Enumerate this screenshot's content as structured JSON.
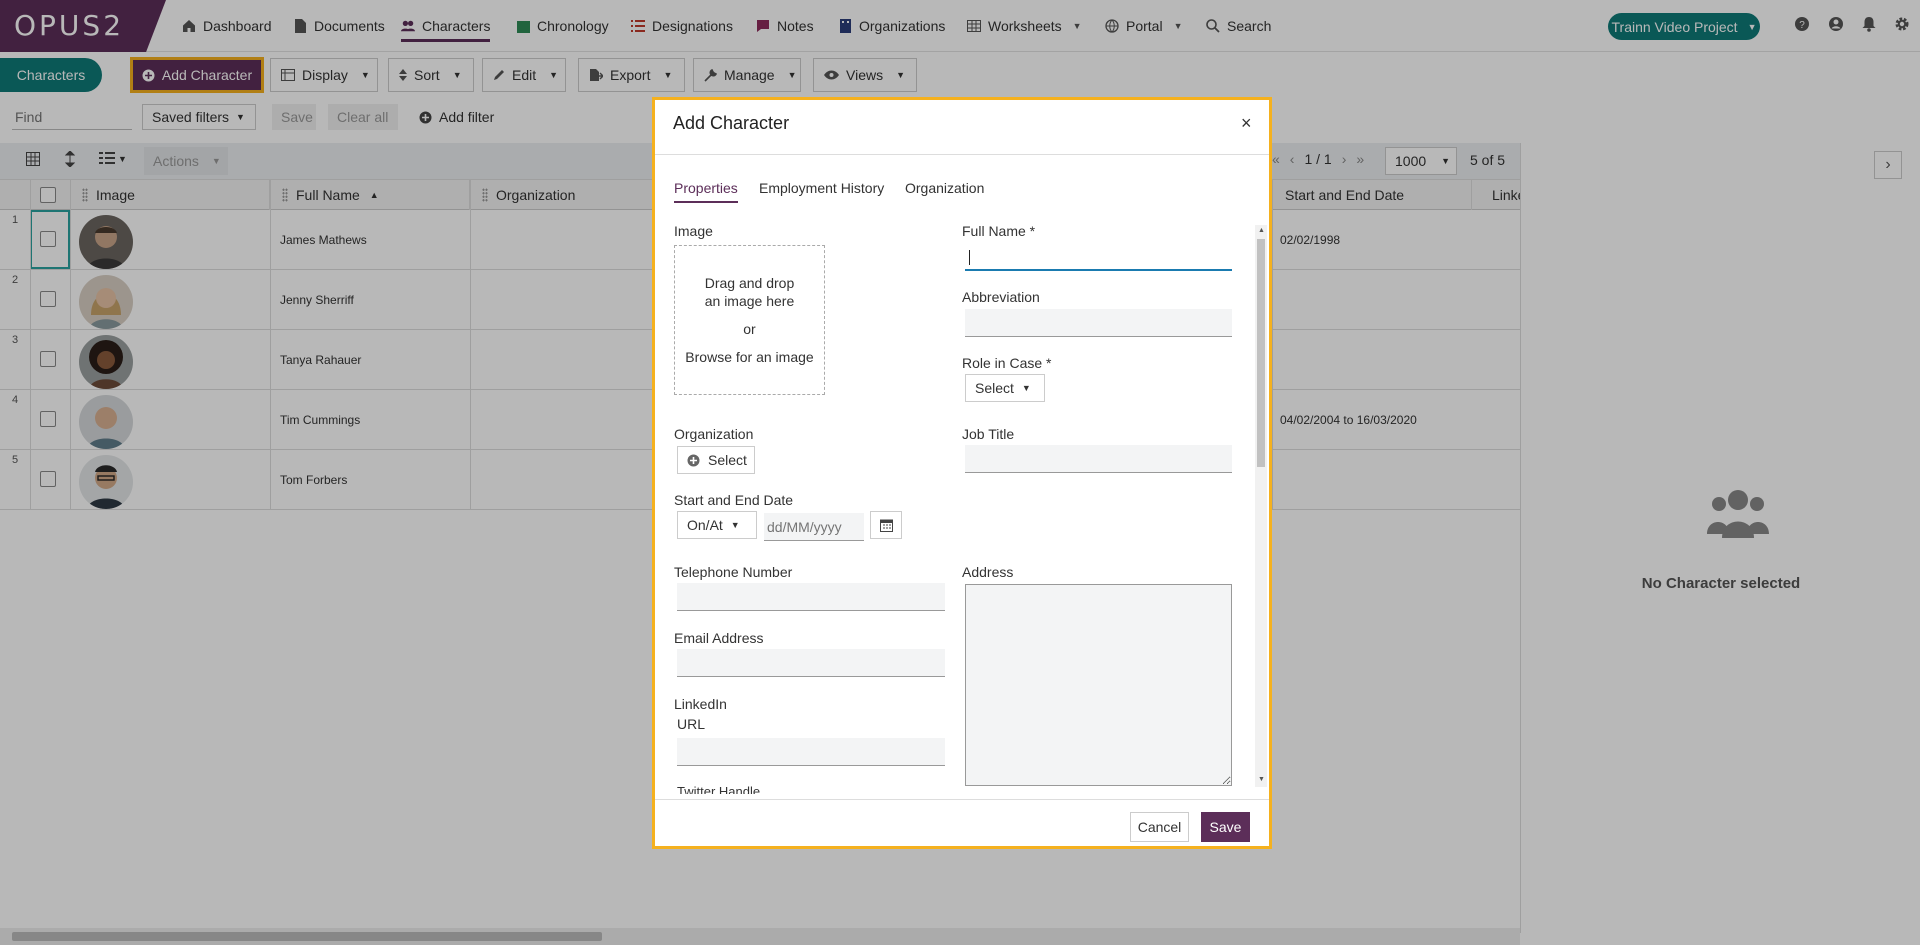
{
  "app": {
    "logo": "OPUS2"
  },
  "nav": {
    "items": [
      {
        "label": "Dashboard",
        "icon": "home-icon"
      },
      {
        "label": "Documents",
        "icon": "document-icon"
      },
      {
        "label": "Characters",
        "icon": "users-icon",
        "active": true
      },
      {
        "label": "Chronology",
        "icon": "calendar-icon"
      },
      {
        "label": "Designations",
        "icon": "list-icon"
      },
      {
        "label": "Notes",
        "icon": "note-icon"
      },
      {
        "label": "Organizations",
        "icon": "building-icon"
      },
      {
        "label": "Worksheets",
        "icon": "table-icon"
      },
      {
        "label": "Portal",
        "icon": "globe-icon"
      },
      {
        "label": "Search",
        "icon": "search-icon"
      }
    ],
    "project": "Trainn Video Project"
  },
  "toolbar": {
    "characters_tab": "Characters",
    "add_character": "Add Character",
    "display": "Display",
    "sort": "Sort",
    "edit": "Edit",
    "export": "Export",
    "manage": "Manage",
    "views": "Views"
  },
  "filters": {
    "find_placeholder": "Find",
    "saved_filters": "Saved filters",
    "save": "Save",
    "clear_all": "Clear all",
    "add_filter": "Add filter"
  },
  "grid_toolbar": {
    "actions": "Actions",
    "pagination": "1 / 1",
    "page_size": "1000",
    "count": "5 of 5"
  },
  "grid": {
    "columns": [
      "Image",
      "Full Name",
      "Organization",
      "Start and End Date",
      "Linke"
    ],
    "rows": [
      {
        "num": "1",
        "name": "James Mathews",
        "date": "02/02/1998"
      },
      {
        "num": "2",
        "name": "Jenny Sherriff",
        "date": ""
      },
      {
        "num": "3",
        "name": "Tanya Rahauer",
        "date": ""
      },
      {
        "num": "4",
        "name": "Tim Cummings",
        "date": "04/02/2004 to 16/03/2020"
      },
      {
        "num": "5",
        "name": "Tom Forbers",
        "date": ""
      }
    ]
  },
  "right_panel": {
    "empty_text": "No Character selected"
  },
  "dialog": {
    "title": "Add Character",
    "close": "×",
    "tabs": [
      "Properties",
      "Employment History",
      "Organization"
    ],
    "image_label": "Image",
    "dropzone": {
      "line1": "Drag and drop",
      "line2": "an image here",
      "or": "or",
      "browse": "Browse for an image"
    },
    "full_name_label": "Full Name *",
    "abbreviation_label": "Abbreviation",
    "role_label": "Role in Case *",
    "role_select": "Select",
    "organization_label": "Organization",
    "organization_select": "Select",
    "job_title_label": "Job Title",
    "date_label": "Start and End Date",
    "date_mode": "On/At",
    "date_placeholder": "dd/MM/yyyy",
    "telephone_label": "Telephone Number",
    "address_label": "Address",
    "email_label": "Email Address",
    "linkedin_label": "LinkedIn",
    "url_label": "URL",
    "cut_label": "Twitter Handle",
    "cancel": "Cancel",
    "save": "Save"
  },
  "colors": {
    "brand": "#5c2e59",
    "teal": "#0e7a78",
    "highlight": "#f5b11e"
  }
}
